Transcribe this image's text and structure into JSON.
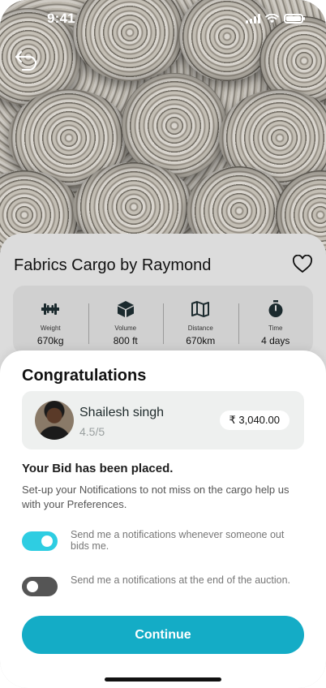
{
  "status_bar": {
    "time": "9:41"
  },
  "cargo": {
    "title": "Fabrics Cargo by Raymond",
    "stats": [
      {
        "icon": "dumbbell-icon",
        "label": "Weight",
        "value": "670kg"
      },
      {
        "icon": "box-icon",
        "label": "Volume",
        "value": "800 ft"
      },
      {
        "icon": "map-icon",
        "label": "Distance",
        "value": "670km"
      },
      {
        "icon": "stopwatch-icon",
        "label": "Time",
        "value": "4 days"
      }
    ]
  },
  "sheet": {
    "title": "Congratulations",
    "bidder": {
      "name": "Shailesh singh",
      "rating": "4.5/5",
      "price": "₹ 3,040.00"
    },
    "placed_heading": "Your Bid has been placed.",
    "subtext": "Set-up your Notifications to not miss on the cargo help us with your Preferences.",
    "preferences": [
      {
        "text": "Send me a notifications whenever someone out bids me.",
        "enabled": true
      },
      {
        "text": "Send me a notifications at the end of the auction.",
        "enabled": false
      }
    ],
    "continue_label": "Continue"
  },
  "colors": {
    "accent": "#14acc6",
    "toggle_on": "#2ecde2",
    "toggle_off": "#555555"
  }
}
